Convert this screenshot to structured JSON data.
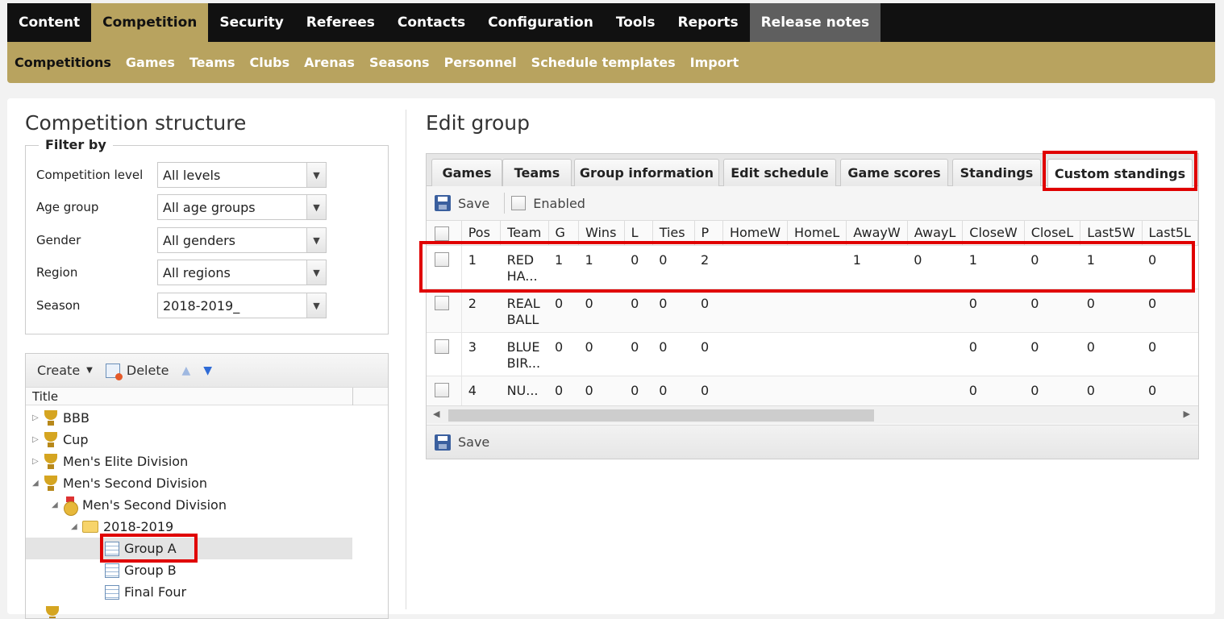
{
  "topnav": [
    "Content",
    "Competition",
    "Security",
    "Referees",
    "Contacts",
    "Configuration",
    "Tools",
    "Reports",
    "Release notes"
  ],
  "subnav": [
    "Competitions",
    "Games",
    "Teams",
    "Clubs",
    "Arenas",
    "Seasons",
    "Personnel",
    "Schedule templates",
    "Import"
  ],
  "left": {
    "title": "Competition structure",
    "filter_legend": "Filter by",
    "filters": [
      {
        "label": "Competition level",
        "value": "All levels"
      },
      {
        "label": "Age group",
        "value": "All age groups"
      },
      {
        "label": "Gender",
        "value": "All genders"
      },
      {
        "label": "Region",
        "value": "All regions"
      },
      {
        "label": "Season",
        "value": "2018-2019_"
      }
    ],
    "toolbar": {
      "create": "Create",
      "delete": "Delete"
    },
    "tree_header": "Title",
    "tree": [
      "BBB",
      "Cup",
      "Men's Elite Division",
      "Men's Second Division",
      "Men's Second Division",
      "2018-2019_",
      "Group A",
      "Group B",
      "Final Four"
    ]
  },
  "right": {
    "title": "Edit group",
    "tabs": [
      "Games",
      "Teams",
      "Group information",
      "Edit schedule",
      "Game scores",
      "Standings",
      "Custom standings"
    ],
    "save_label": "Save",
    "enabled_label": "Enabled",
    "columns": [
      "Pos",
      "Team",
      "G",
      "Wins",
      "L",
      "Ties",
      "P",
      "HomeW",
      "HomeL",
      "AwayW",
      "AwayL",
      "CloseW",
      "CloseL",
      "Last5W",
      "Last5L"
    ],
    "rows": [
      [
        "1",
        "RED HA...",
        "1",
        "1",
        "0",
        "0",
        "2",
        "",
        "",
        "1",
        "0",
        "1",
        "0",
        "1",
        "0"
      ],
      [
        "2",
        "REAL BALL",
        "0",
        "0",
        "0",
        "0",
        "0",
        "",
        "",
        "",
        "",
        "0",
        "0",
        "0",
        "0"
      ],
      [
        "3",
        "BLUE BIR...",
        "0",
        "0",
        "0",
        "0",
        "0",
        "",
        "",
        "",
        "",
        "0",
        "0",
        "0",
        "0"
      ],
      [
        "4",
        "NU...",
        "0",
        "0",
        "0",
        "0",
        "0",
        "",
        "",
        "",
        "",
        "0",
        "0",
        "0",
        "0"
      ]
    ]
  },
  "colors": {
    "gold": "#b8a35f",
    "nav_dark": "#111111",
    "highlight": "#e00000"
  }
}
